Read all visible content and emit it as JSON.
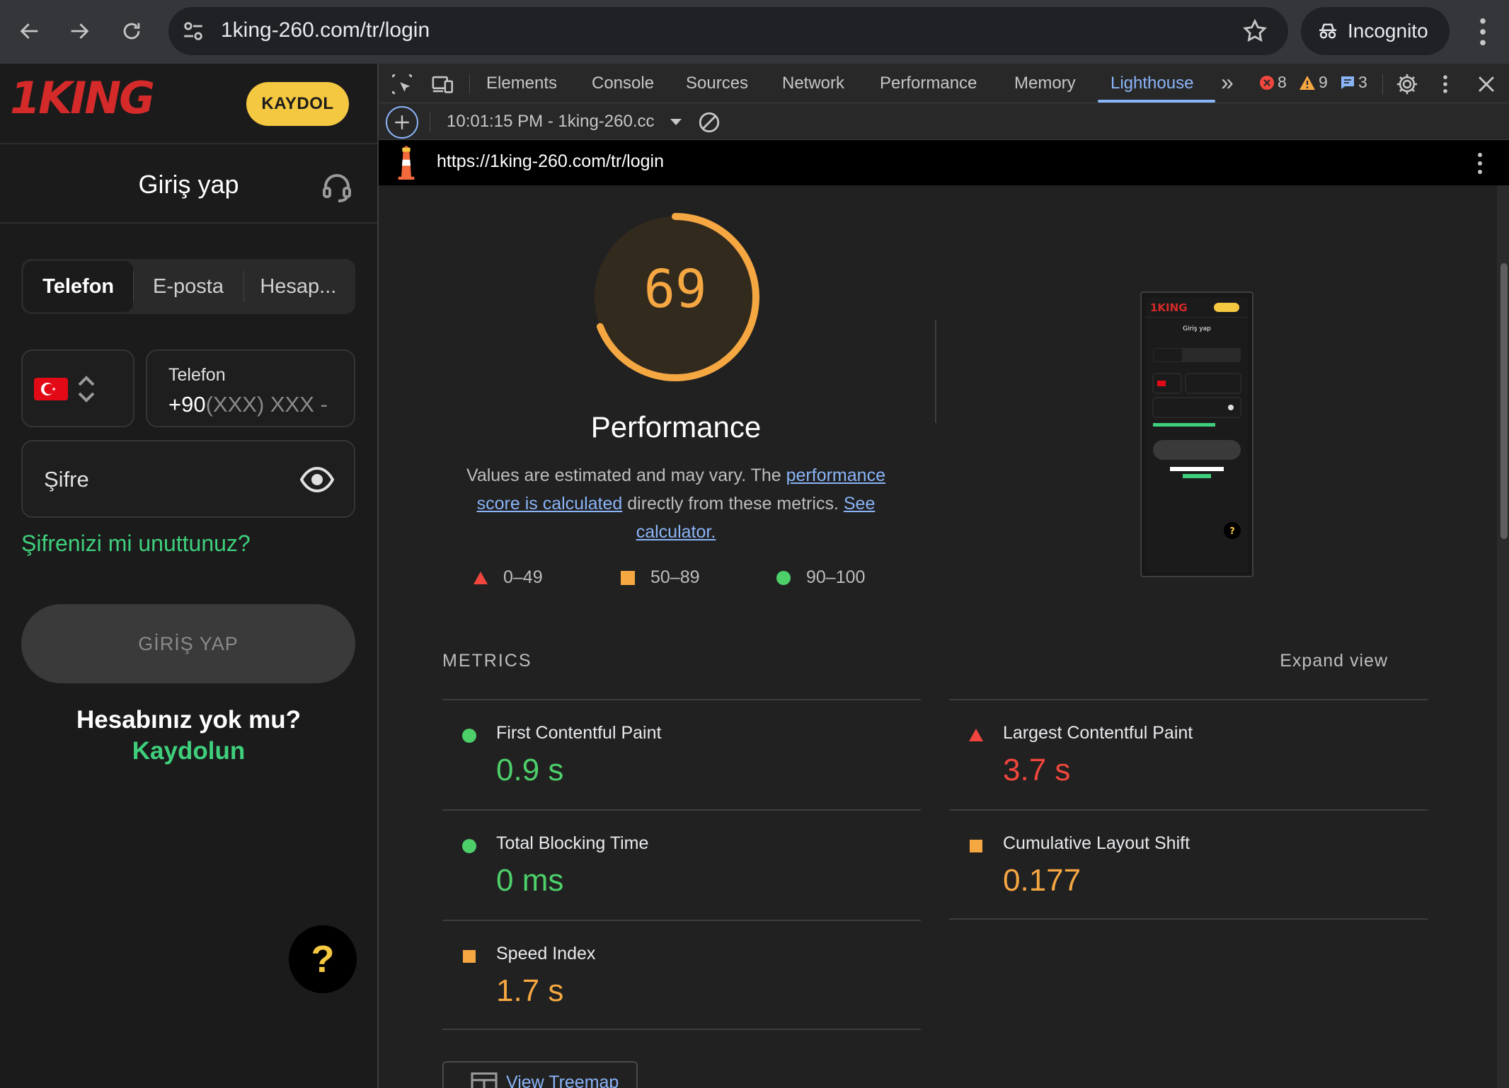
{
  "browser": {
    "url": "1king-260.com/tr/login",
    "incognito_label": "Incognito"
  },
  "site": {
    "logo_text": "1KING",
    "register_button": "KAYDOL",
    "login_title": "Giriş yap",
    "tabs": [
      "Telefon",
      "E-posta",
      "Hesap..."
    ],
    "phone_label": "Telefon",
    "phone_prefix": "+90",
    "phone_placeholder": "(XXX) XXX -",
    "password_label": "Şifre",
    "forgot_password": "Şifrenizi mi unuttunuz?",
    "login_button": "GİRİŞ YAP",
    "no_account": "Hesabınız yok mu?",
    "register_link": "Kaydolun",
    "help_label": "?",
    "colors": {
      "accent_yellow": "#f5c842",
      "brand_red": "#d42a2a",
      "link_green": "#3fcf7c"
    }
  },
  "devtools": {
    "tabs": [
      "Elements",
      "Console",
      "Sources",
      "Network",
      "Performance",
      "Memory",
      "Lighthouse"
    ],
    "more_tabs": "»",
    "errors": "8",
    "warnings": "9",
    "messages": "3",
    "report_select": "10:01:15 PM - 1king-260.cc",
    "report_url": "https://1king-260.com/tr/login"
  },
  "lighthouse": {
    "score": "69",
    "score_fraction": 0.69,
    "category": "Performance",
    "desc_1": "Values are estimated and may vary. The ",
    "desc_link_1": "performance score is calculated",
    "desc_2": " directly from these metrics. ",
    "desc_link_2": "See calculator.",
    "legend": [
      "0–49",
      "50–89",
      "90–100"
    ],
    "metrics_header": "METRICS",
    "expand_view": "Expand view",
    "metrics": [
      {
        "name": "First Contentful Paint",
        "value": "0.9 s",
        "rating": "good"
      },
      {
        "name": "Largest Contentful Paint",
        "value": "3.7 s",
        "rating": "bad"
      },
      {
        "name": "Total Blocking Time",
        "value": "0 ms",
        "rating": "good"
      },
      {
        "name": "Cumulative Layout Shift",
        "value": "0.177",
        "rating": "avg"
      },
      {
        "name": "Speed Index",
        "value": "1.7 s",
        "rating": "avg"
      }
    ],
    "treemap_button": "View Treemap",
    "colors": {
      "good": "#4dcf6a",
      "average": "#f5a742",
      "fail": "#f0463d"
    }
  }
}
